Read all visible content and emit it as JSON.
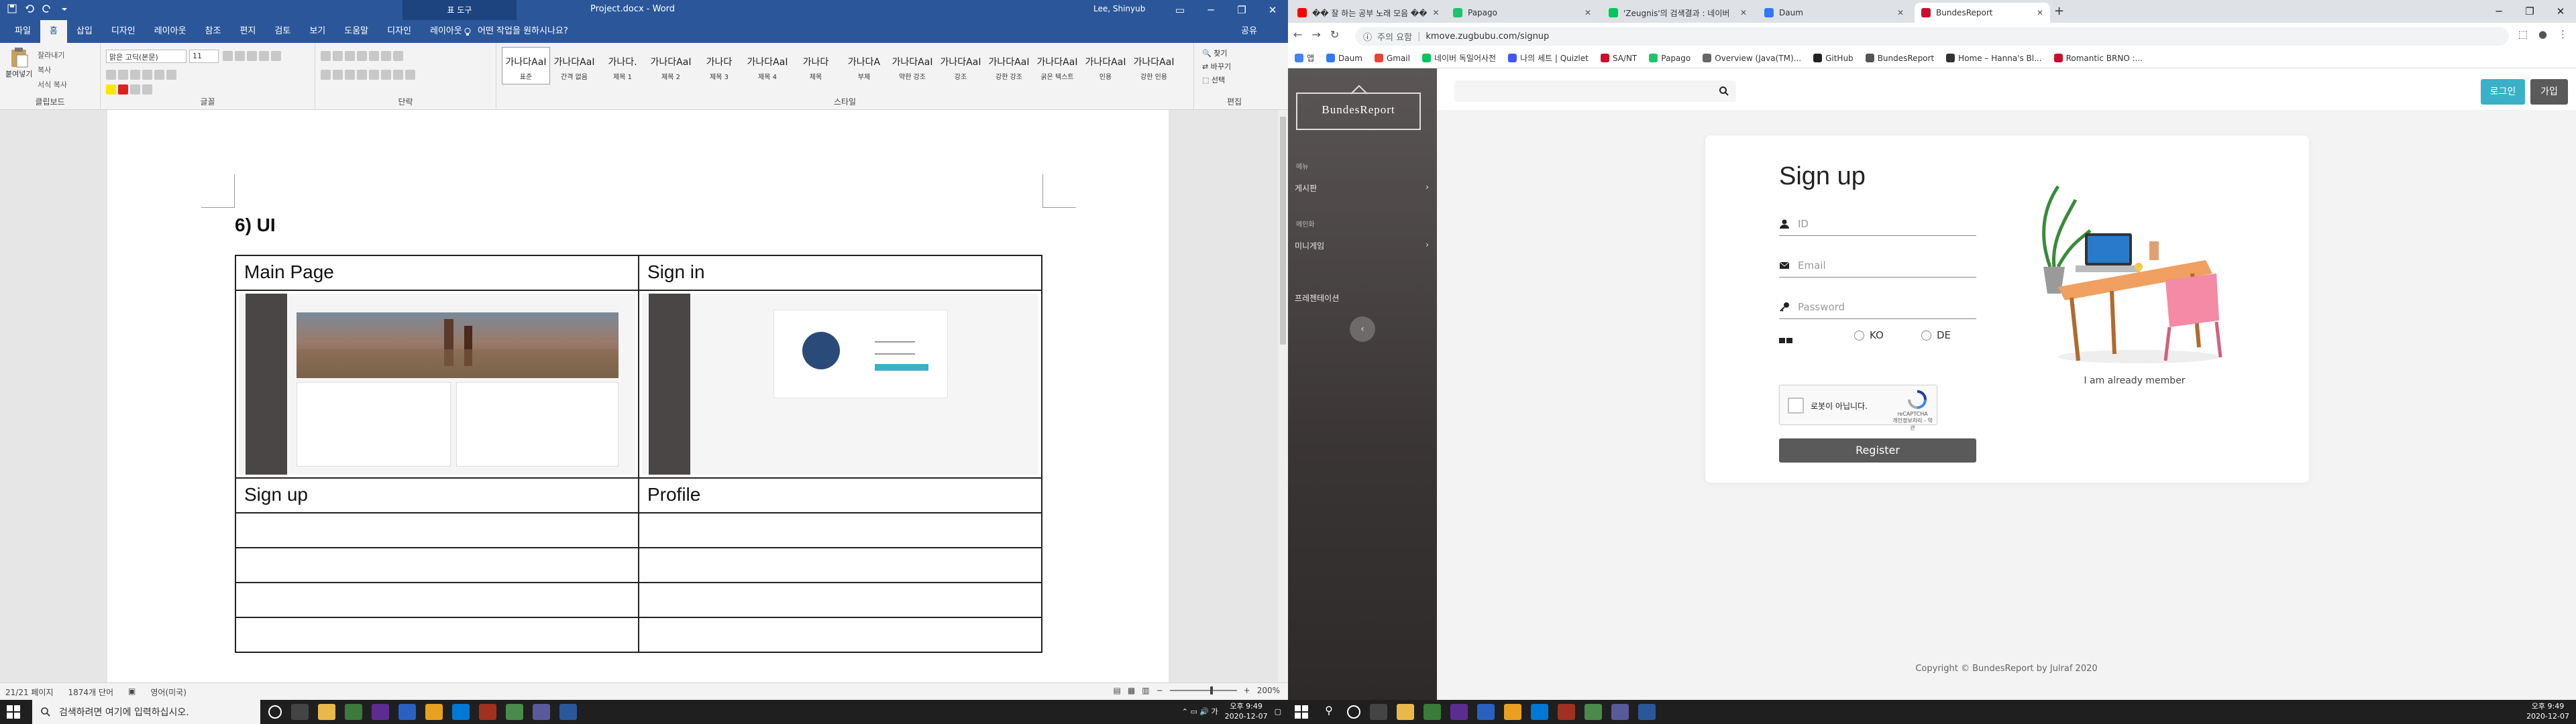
{
  "word": {
    "context_tab_group": "표 도구",
    "doc_title": "Project.docx  -  Word",
    "user": "Lee, Shinyub",
    "tabs": [
      "파일",
      "홈",
      "삽입",
      "디자인",
      "레이아웃",
      "참조",
      "편지",
      "검토",
      "보기",
      "도움말",
      "디자인",
      "레이아웃"
    ],
    "active_tab_index": 1,
    "tell_me": "어떤 작업을 원하시나요?",
    "share": "공유",
    "ribbon": {
      "clipboard": {
        "label": "클립보드",
        "paste": "붙여넣기",
        "cut": "잘라내기",
        "copy": "복사",
        "format_painter": "서식 복사"
      },
      "font": {
        "label": "글꼴",
        "font_name": "맑은 고딕(본문)",
        "font_size": "11"
      },
      "paragraph": {
        "label": "단락"
      },
      "styles": {
        "label": "스타일",
        "items": [
          {
            "sample": "가나다AaI",
            "name": "표준"
          },
          {
            "sample": "가나다AaI",
            "name": "간격 없음"
          },
          {
            "sample": "가나다.",
            "name": "제목 1"
          },
          {
            "sample": "가나다AaI",
            "name": "제목 2"
          },
          {
            "sample": "가나다",
            "name": "제목 3"
          },
          {
            "sample": "가나다AaI",
            "name": "제목 4"
          },
          {
            "sample": "가나다",
            "name": "제목"
          },
          {
            "sample": "가나다A",
            "name": "부제"
          },
          {
            "sample": "가나다AaI",
            "name": "약한 강조"
          },
          {
            "sample": "가나다AaI",
            "name": "강조"
          },
          {
            "sample": "가나다AaI",
            "name": "강한 강조"
          },
          {
            "sample": "가나다AaI",
            "name": "굵은 텍스트"
          },
          {
            "sample": "가나다AaI",
            "name": "인용"
          },
          {
            "sample": "가나다AaI",
            "name": "강한 인용"
          }
        ]
      },
      "editing": {
        "label": "편집",
        "find": "찾기",
        "replace": "바꾸기",
        "select": "선택"
      }
    },
    "heading": "6) UI",
    "table": {
      "r1": [
        "Main Page",
        "Sign in"
      ],
      "r3": [
        "Sign up",
        "Profile"
      ]
    },
    "status": {
      "page": "21/21 페이지",
      "words": "1874개 단어",
      "lang": "영어(미국)",
      "zoom": "200%"
    }
  },
  "chrome": {
    "tabs": [
      {
        "title": "�� 잘 하는 공부 노래 모음 ��",
        "color": "#ff0000"
      },
      {
        "title": "Papago",
        "color": "#1fc46a"
      },
      {
        "title": "'Zeugnis'의 검색결과 : 네이버",
        "color": "#03c75a"
      },
      {
        "title": "Daum",
        "color": "#3478f6"
      },
      {
        "title": "BundesReport",
        "color": "#c8102e"
      }
    ],
    "active_tab_index": 4,
    "security": "주의 요함",
    "url": "kmove.zugbubu.com/signup",
    "bookmarks": [
      "앱",
      "Daum",
      "Gmail",
      "네이버 독일어사전",
      "나의 세트 | Quizlet",
      "SA/NT",
      "Papago",
      "Overview (Java(TM)...",
      "GitHub",
      "BundesReport",
      "Home – Hanna's Bl...",
      "Romantic BRNO :..."
    ]
  },
  "site": {
    "logo": "BundesReport",
    "sidebar": [
      {
        "sub": "메뉴"
      },
      {
        "label": "게시판"
      },
      {
        "sub": "메인화"
      },
      {
        "label": "미니게임"
      },
      {
        "label": "프레젠테이션"
      }
    ],
    "login": "로그인",
    "join": "가입",
    "form": {
      "title": "Sign up",
      "id_placeholder": "ID",
      "email_placeholder": "Email",
      "password_placeholder": "Password",
      "lang_ko": "KO",
      "lang_de": "DE",
      "captcha_label": "로봇이 아닙니다.",
      "captcha_brand": "reCAPTCHA",
      "captcha_terms": "개인정보처리 - 약관",
      "register": "Register",
      "already": "I am already member"
    },
    "footer": "Copyright © BundesReport by Julraf 2020"
  },
  "taskbar": {
    "search_placeholder": "검색하려면 여기에 입력하십시오.",
    "time": "오후 9:49",
    "date": "2020-12-07"
  },
  "colors": {
    "word_blue": "#2b579a",
    "login_cyan": "#3bb0c9",
    "register_gray": "#5a5a5a"
  }
}
